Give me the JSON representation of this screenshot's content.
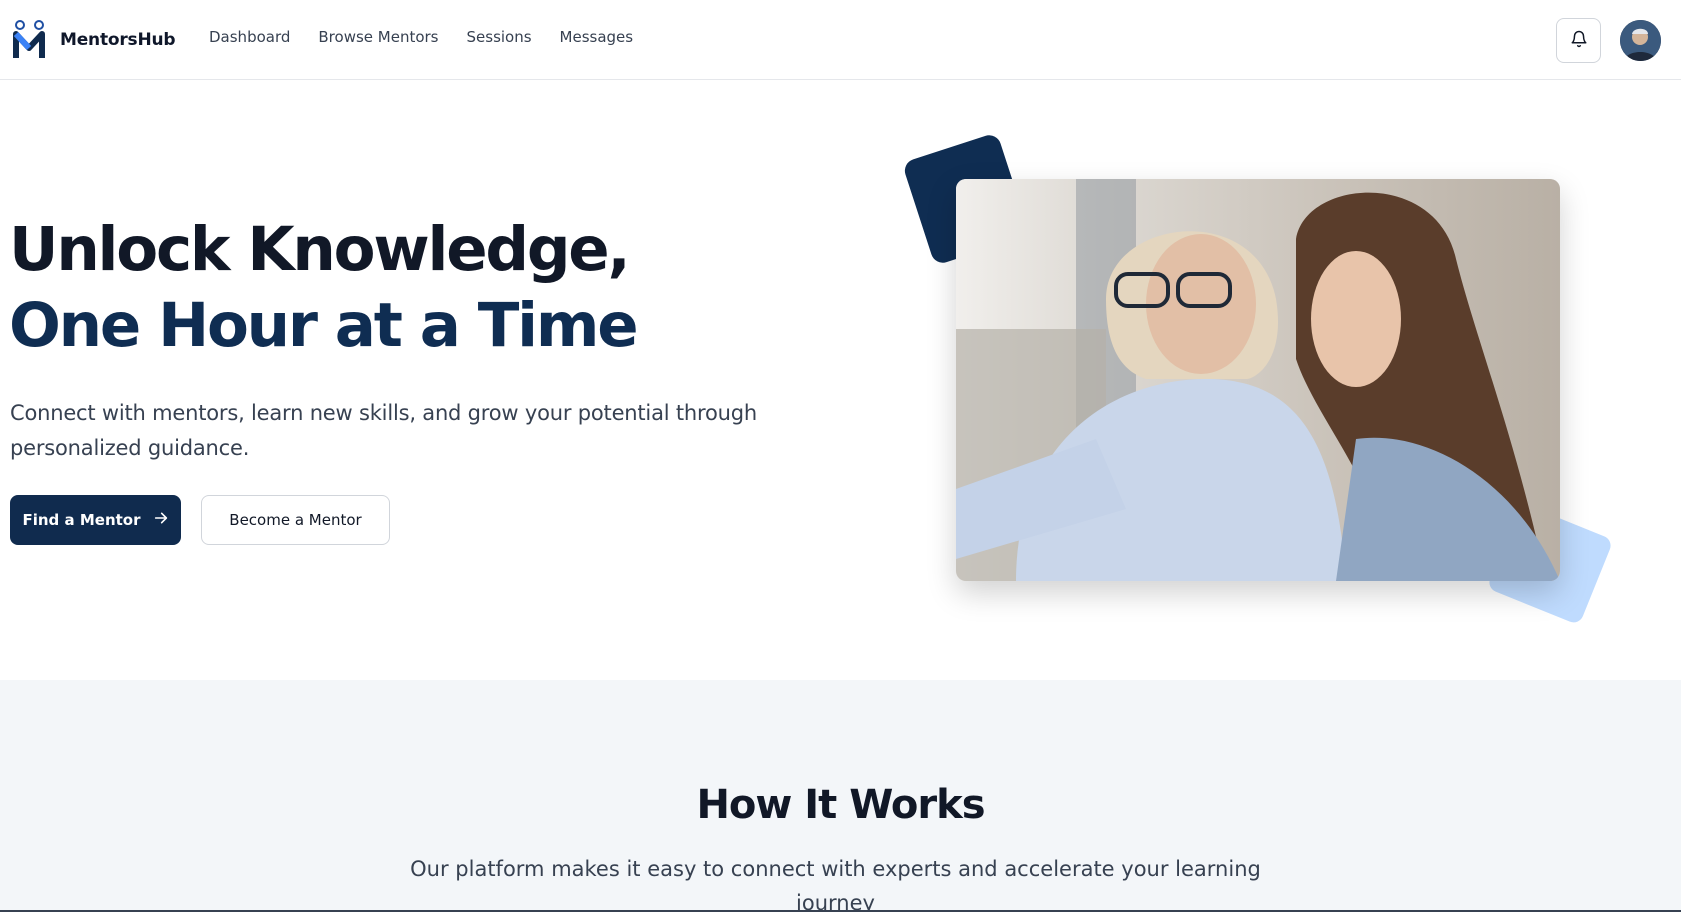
{
  "header": {
    "brand": "MentorsHub",
    "nav": [
      "Dashboard",
      "Browse Mentors",
      "Sessions",
      "Messages"
    ],
    "notification_icon": "bell-icon",
    "avatar_icon": "user-avatar"
  },
  "hero": {
    "title_part1": "Unlock Knowledge, ",
    "title_part2": "One Hour at a Time",
    "subtitle": "Connect with mentors, learn new skills, and grow your potential through personalized guidance.",
    "primary_button": "Find a Mentor",
    "secondary_button": "Become a Mentor",
    "primary_button_icon": "arrow-right-icon"
  },
  "how_it_works": {
    "title": "How It Works",
    "subtitle": "Our platform makes it easy to connect with experts and accelerate your learning journey"
  },
  "colors": {
    "brand_navy": "#0f2d52",
    "accent_light_blue": "#bfdbfe",
    "section_bg": "#f3f6f9"
  }
}
